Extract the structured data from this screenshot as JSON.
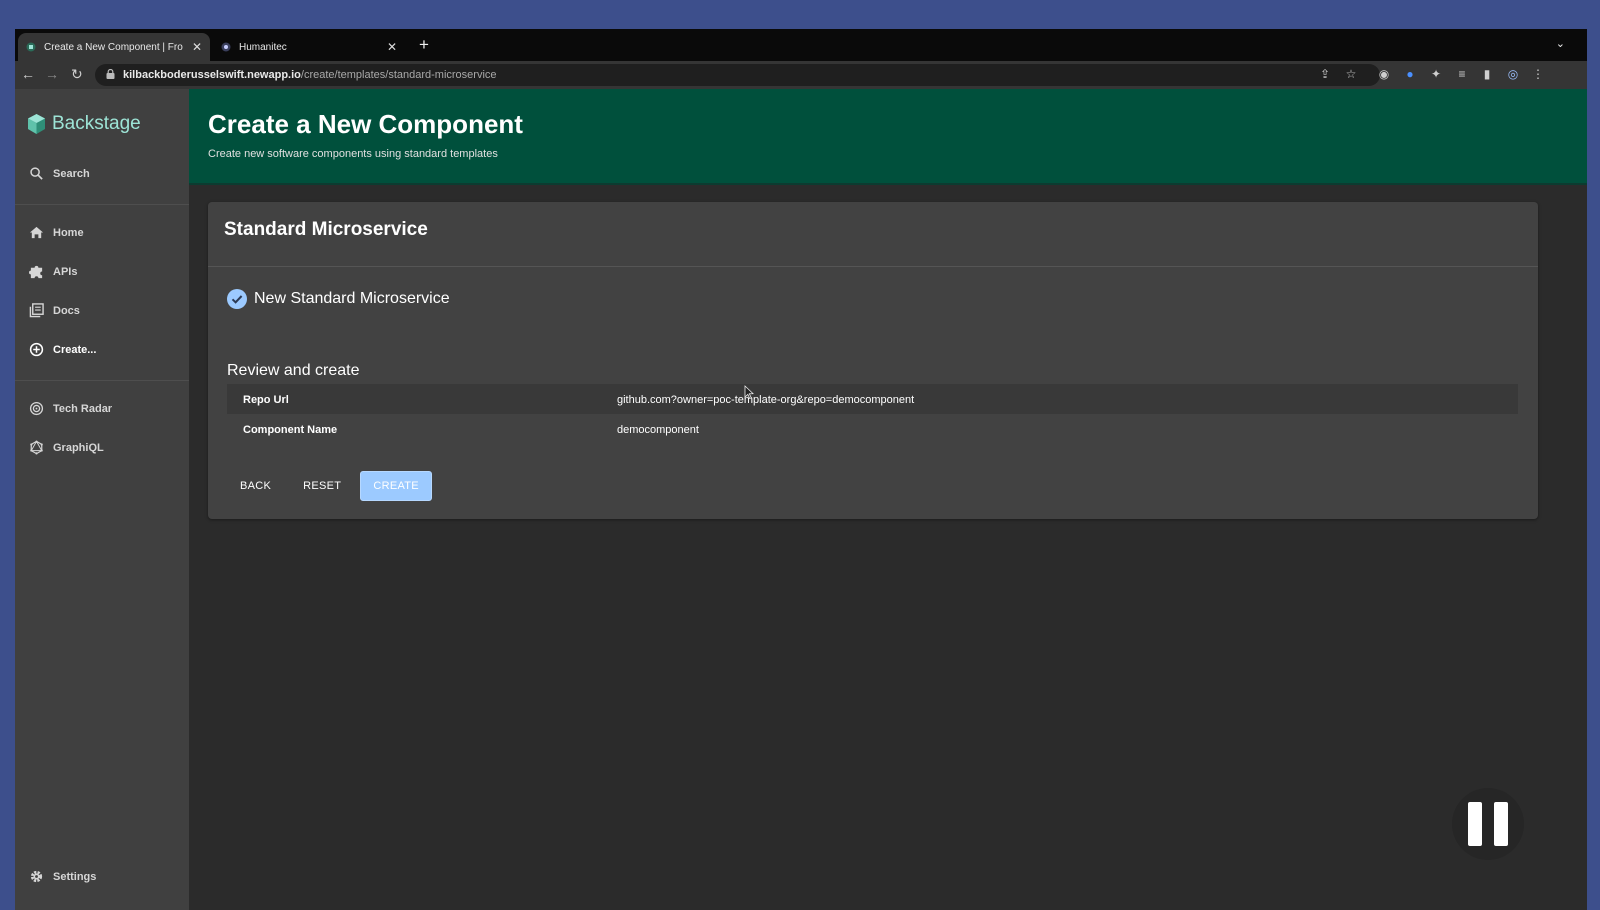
{
  "browser": {
    "tabs": [
      {
        "title": "Create a New Component | Fro",
        "active": true
      },
      {
        "title": "Humanitec",
        "active": false
      }
    ],
    "url_host": "kilbackboderusselswift.newapp.io",
    "url_path": "/create/templates/standard-microservice"
  },
  "sidebar": {
    "brand": "Backstage",
    "search_label": "Search",
    "items": [
      {
        "label": "Home",
        "icon": "home-icon"
      },
      {
        "label": "APIs",
        "icon": "puzzle-icon"
      },
      {
        "label": "Docs",
        "icon": "library-icon"
      },
      {
        "label": "Create...",
        "icon": "add-circle-icon"
      },
      {
        "label": "Tech Radar",
        "icon": "radar-icon"
      },
      {
        "label": "GraphiQL",
        "icon": "graphiql-icon"
      }
    ],
    "settings_label": "Settings"
  },
  "header": {
    "title": "Create a New Component",
    "subtitle": "Create new software components using standard templates"
  },
  "card": {
    "title": "Standard Microservice",
    "step_label": "New Standard Microservice",
    "review_title": "Review and create",
    "review_rows": [
      {
        "key": "Repo Url",
        "value": "github.com?owner=poc-template-org&repo=democomponent"
      },
      {
        "key": "Component Name",
        "value": "democomponent"
      }
    ],
    "buttons": {
      "back": "BACK",
      "reset": "RESET",
      "create": "CREATE"
    }
  },
  "colors": {
    "header_bg": "#00503c",
    "brand": "#9de4d6",
    "primary_button": "#9ccaff",
    "sidebar_bg": "#404040"
  }
}
